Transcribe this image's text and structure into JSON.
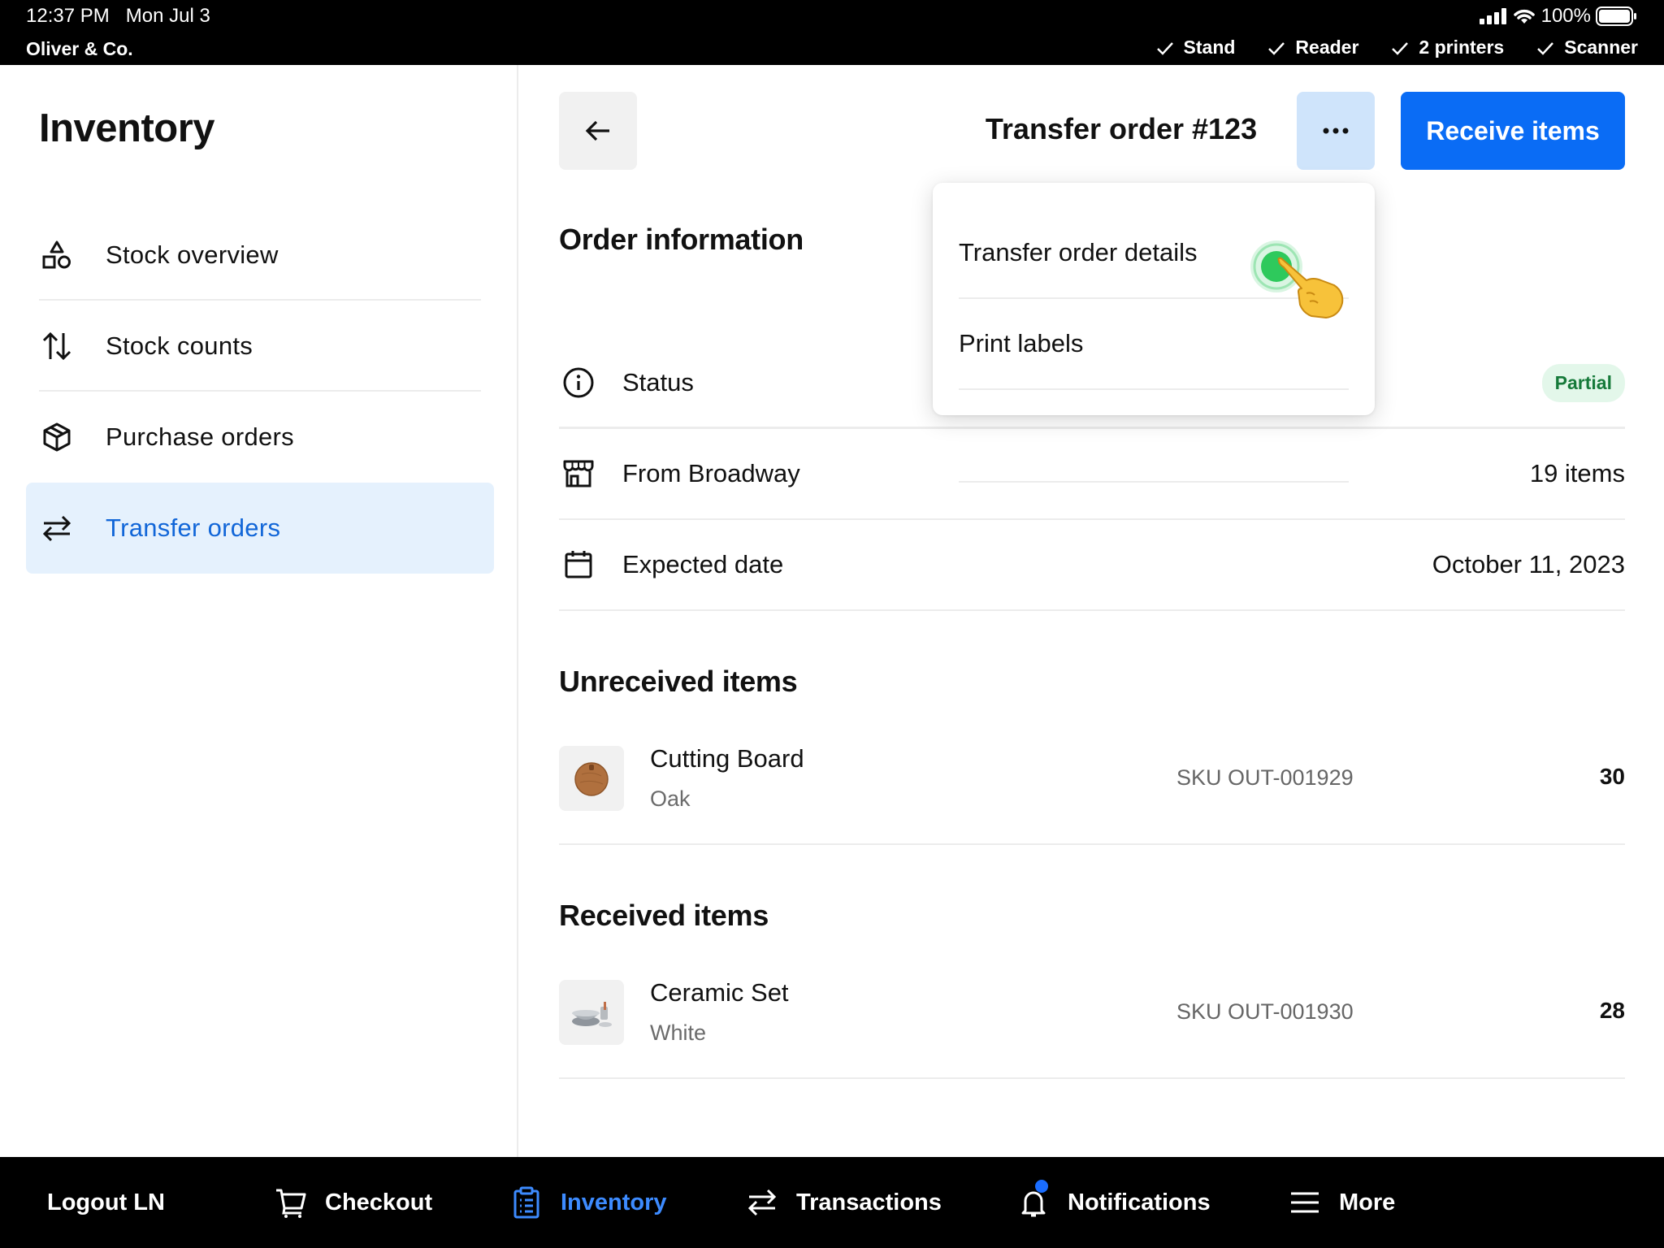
{
  "status_bar": {
    "time": "12:37 PM",
    "date": "Mon Jul 3",
    "merchant": "Oliver & Co.",
    "battery": "100%",
    "devices": [
      "Stand",
      "Reader",
      "2 printers",
      "Scanner"
    ]
  },
  "sidebar": {
    "title": "Inventory",
    "items": [
      {
        "label": "Stock overview",
        "icon": "shapes-icon"
      },
      {
        "label": "Stock counts",
        "icon": "arrows-up-down-icon"
      },
      {
        "label": "Purchase orders",
        "icon": "box-icon"
      },
      {
        "label": "Transfer orders",
        "icon": "arrows-left-right-icon",
        "active": true
      }
    ]
  },
  "header": {
    "title": "Transfer order #123",
    "receive_label": "Receive items"
  },
  "order_info": {
    "title": "Order information",
    "rows": [
      {
        "label": "Status",
        "value": "Partial",
        "icon": "info-icon"
      },
      {
        "label": "From Broadway",
        "value": "19 items",
        "icon": "store-icon"
      },
      {
        "label": "Expected date",
        "value": "October 11, 2023",
        "icon": "calendar-icon"
      }
    ]
  },
  "unreceived": {
    "title": "Unreceived items",
    "items": [
      {
        "name": "Cutting Board",
        "variant": "Oak",
        "sku": "SKU OUT-001929",
        "qty": "30"
      }
    ]
  },
  "received": {
    "title": "Received items",
    "items": [
      {
        "name": "Ceramic Set",
        "variant": "White",
        "sku": "SKU OUT-001930",
        "qty": "28"
      }
    ]
  },
  "menu": {
    "items": [
      "Transfer order details",
      "Print labels"
    ]
  },
  "tabbar": {
    "logout": "Logout LN",
    "tabs": [
      {
        "label": "Checkout",
        "icon": "cart-icon"
      },
      {
        "label": "Inventory",
        "icon": "clipboard-icon",
        "active": true
      },
      {
        "label": "Transactions",
        "icon": "arrows-left-right-icon"
      },
      {
        "label": "Notifications",
        "icon": "bell-icon"
      },
      {
        "label": "More",
        "icon": "menu-icon"
      }
    ]
  },
  "colors": {
    "accent": "#0a6cf5",
    "active_bg": "#e5f1fd",
    "badge_bg": "#e3f7ea",
    "badge_text": "#167a3a",
    "touch_indicator": "#2ec95c"
  }
}
